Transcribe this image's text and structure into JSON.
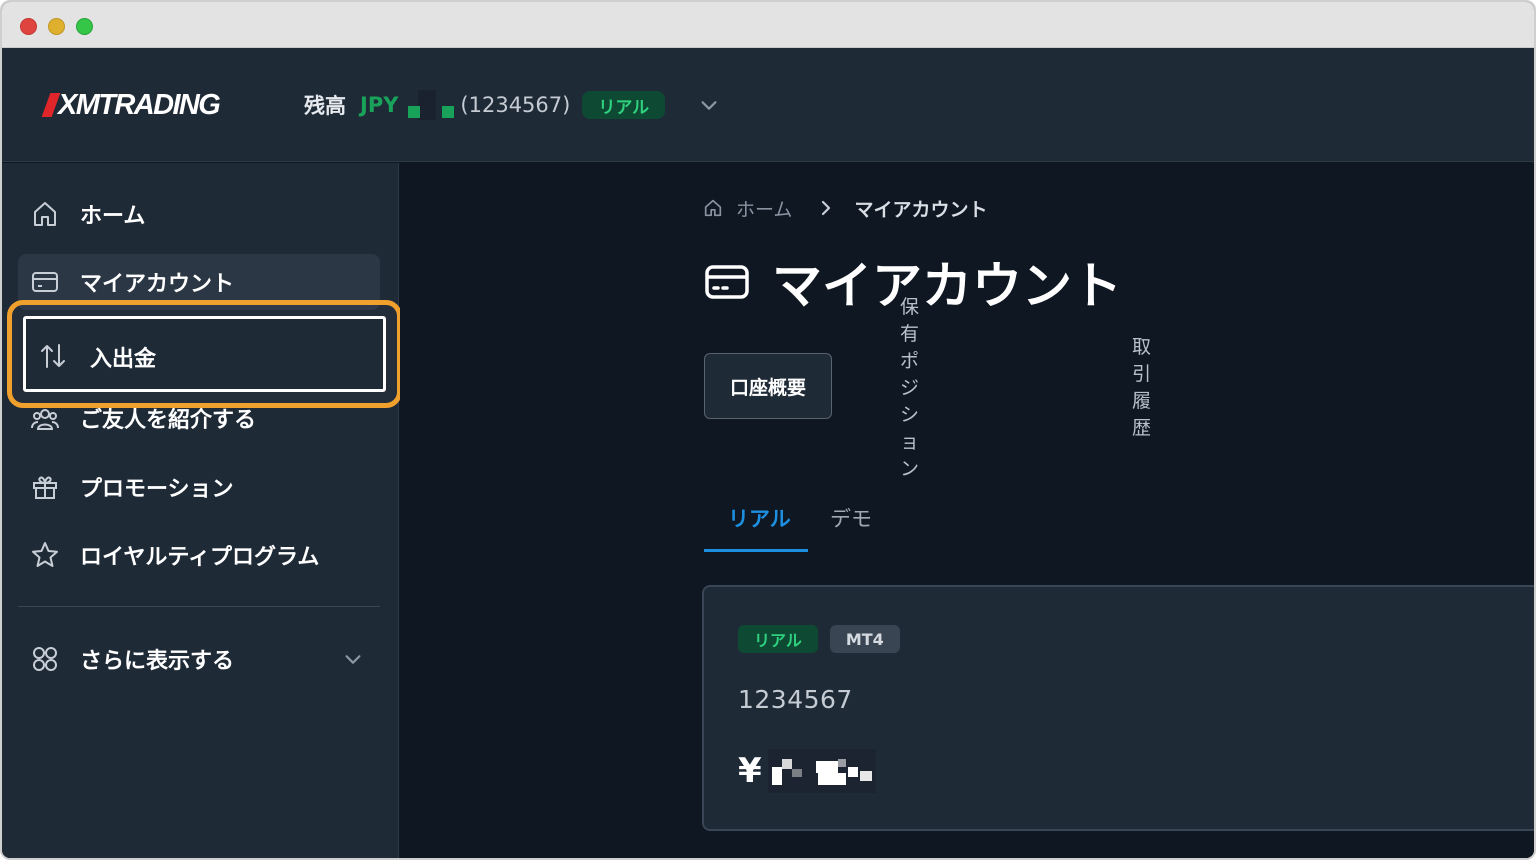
{
  "window": {
    "buttons": [
      "close",
      "minimize",
      "maximize"
    ]
  },
  "header": {
    "logo_text": "XMTRADING",
    "balance_label": "残高",
    "balance_currency": "JPY",
    "account_id": "(1234567)",
    "account_type_badge": "リアル"
  },
  "sidebar": {
    "items": [
      {
        "label": "ホーム",
        "icon": "home-icon"
      },
      {
        "label": "マイアカウント",
        "icon": "card-icon"
      },
      {
        "label": "入出金",
        "icon": "transfer-arrows-icon"
      },
      {
        "label": "ご友人を紹介する",
        "icon": "users-icon"
      },
      {
        "label": "プロモーション",
        "icon": "gift-icon"
      },
      {
        "label": "ロイヤルティプログラム",
        "icon": "star-icon"
      }
    ],
    "more_label": "さらに表示する",
    "more_icon": "grid-icon"
  },
  "breadcrumb": {
    "home": "ホーム",
    "current": "マイアカウント"
  },
  "page": {
    "title": "マイアカウント",
    "tabs": [
      "口座概要",
      "保有ポジション",
      "取引履歴"
    ],
    "sub_tabs": [
      "リアル",
      "デモ"
    ]
  },
  "account_card": {
    "badge_real": "リアル",
    "badge_platform": "MT4",
    "account_number": "1234567",
    "currency_symbol": "¥"
  },
  "colors": {
    "accent_green": "#19a35a",
    "accent_blue": "#1d8fe1",
    "highlight_orange": "#f0a02c",
    "brand_red": "#e0262b"
  }
}
